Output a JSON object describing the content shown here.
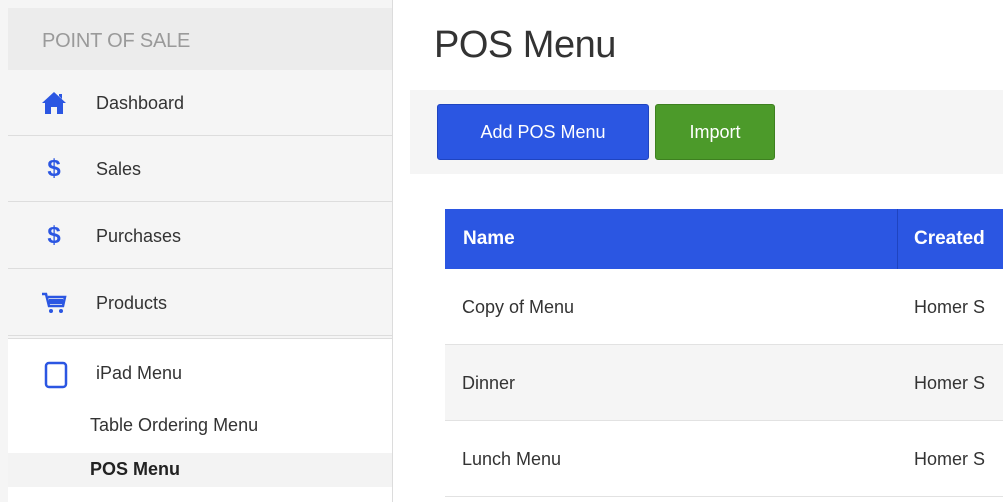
{
  "sidebar": {
    "header": "POINT OF SALE",
    "items": [
      {
        "label": "Dashboard",
        "icon": "home-icon"
      },
      {
        "label": "Sales",
        "icon": "dollar-icon"
      },
      {
        "label": "Purchases",
        "icon": "dollar-icon"
      },
      {
        "label": "Products",
        "icon": "cart-icon"
      },
      {
        "label": "iPad Menu",
        "icon": "tablet-icon"
      }
    ],
    "sub_items": [
      {
        "label": "Table Ordering Menu",
        "active": false
      },
      {
        "label": "POS Menu",
        "active": true
      }
    ]
  },
  "main": {
    "title": "POS Menu",
    "buttons": {
      "add": "Add POS Menu",
      "import": "Import"
    },
    "table": {
      "columns": [
        "Name",
        "Created"
      ],
      "rows": [
        {
          "name": "Copy of Menu",
          "created": "Homer S"
        },
        {
          "name": "Dinner",
          "created": "Homer S"
        },
        {
          "name": "Lunch Menu",
          "created": "Homer S"
        }
      ]
    }
  },
  "colors": {
    "accent": "#2b56e2",
    "import": "#4c9a2a",
    "sidebar_bg": "#f5f5f5"
  }
}
